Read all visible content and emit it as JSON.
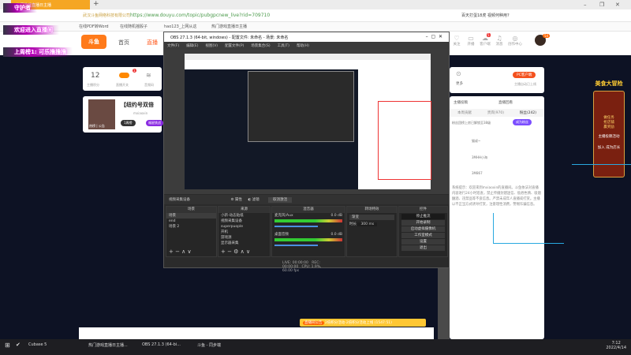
{
  "browser": {
    "tab_title": "热门游戏直播日主播",
    "new_tab": "+",
    "url": "https://www.douyu.com/topic/pubgpcnew_live?rid=709710",
    "site_name": "武汉斗鱼网络科技有限公司",
    "search_text": "百天打蛋18虎 视频何种用?",
    "bookmarks": [
      "在线PDF转Word",
      "在线随机摇骰子",
      "hao123_上网从这",
      "热门游戏直播日主播"
    ]
  },
  "overlays": [
    "守护者",
    "欢迎进入直播间",
    "上周榜1: 可乐撸撸撸"
  ],
  "site": {
    "logo": "斗鱼",
    "nav": [
      "首页",
      "直播"
    ],
    "top_icons": [
      "关注",
      "开播",
      "客户端",
      "消息",
      "创作中心"
    ],
    "msg_badge": "5",
    "avatar_badge": "54"
  },
  "left_card": {
    "score": "12",
    "score_label": "主播积分",
    "toggle_label": "直播开关",
    "sound_label": "音频码",
    "badge": "1"
  },
  "streamer": {
    "title": "【纽约号双倍",
    "name": "mxiaoxin",
    "tags": [
      "热榜",
      "公告"
    ],
    "btn1": "1周榜",
    "btn2": "福星挑战"
  },
  "right_panel": {
    "more": "更多",
    "pc_client": "PC客户端",
    "pc_sub": "主播自动已上线",
    "tab_rank": "主播投稿",
    "tab_live": "直播回看",
    "tabs": [
      "本周贡献",
      "贵宾(970)",
      "粉丝(242)"
    ],
    "fan_hint": "粉丝团榜上房已解锁至38级",
    "join_fan": "成为粉丝",
    "users": [
      "猫叔~",
      "3MHH小海",
      "3M867"
    ],
    "notice": "系统提示：欢迎来到mxiaoxin的直播间。斗鱼依法对直播内容进行24小时巡查，禁止传播封建迷信、低俗色情、吸烟酗酒、违禁品等不良信息。严禁未成年人直播或打赏。主播以不正当方式诱导打赏，注意理性消费，警惕诈骗信息。"
  },
  "game_banner": {
    "title": "美食大冒险",
    "lines": [
      "做任务",
      "抢店铺",
      "赢奖励"
    ],
    "sub": "主播投稿活动",
    "join": "加入 成为店长"
  },
  "notice_bar": {
    "tag": "直播间公告",
    "text": "2倍积分活动-2倍积分活动上线 (1547:51)"
  },
  "obs": {
    "title": "OBS 27.1.3 (64-bit, windows) - 配置文件: 未命名 - 场景: 未命名",
    "menu": [
      "文件(F)",
      "编辑(E)",
      "视图(V)",
      "配置文件(P)",
      "场景集合(S)",
      "工具(T)",
      "帮助(H)"
    ],
    "source_bar": {
      "source": "视频采集设备",
      "props": "属性",
      "filters": "滤镜",
      "deactivate": "取消激活"
    },
    "docks": {
      "scenes": "场景",
      "sources": "来源",
      "mixer": "混音器",
      "transitions": "转场特效",
      "controls": "控件"
    },
    "scenes": [
      "场景",
      "end",
      "场景 2"
    ],
    "sources": [
      "小新-动态贴纸",
      "视频采集设备",
      "superpuople",
      "开机",
      "游戏源",
      "显示器采集"
    ],
    "mixer": [
      {
        "name": "麦克风/Aux",
        "db": "0.0 dB"
      },
      {
        "name": "桌面音频",
        "db": "0.0 dB"
      }
    ],
    "transition": {
      "type": "渐变",
      "duration_label": "时长",
      "duration": "300 ms"
    },
    "controls": [
      "停止推流",
      "开始录制",
      "启动虚拟摄像机",
      "工作室模式",
      "设置",
      "退出"
    ],
    "status": {
      "live": "LIVE: 00:00:00",
      "rec": "REC: 00:00:00",
      "cpu": "CPU: 1.9%, 60.00 fps"
    }
  },
  "taskbar": {
    "items": [
      "Cubase 5",
      "热门游戏直播日主播...",
      "OBS 27.1.3 (64-bi...",
      "斗鱼 - 同步端"
    ],
    "time": "7:12",
    "date": "2022/4/14"
  }
}
